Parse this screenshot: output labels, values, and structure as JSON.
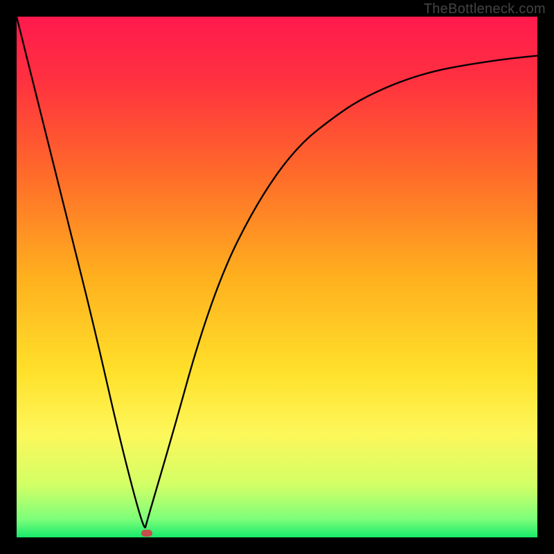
{
  "watermark": "TheBottleneck.com",
  "colors": {
    "frame": "#000000",
    "curve": "#000000",
    "marker": "#c44e4b",
    "gradient_stops": [
      {
        "offset": 0.0,
        "color": "#ff1a4d"
      },
      {
        "offset": 0.12,
        "color": "#ff3040"
      },
      {
        "offset": 0.3,
        "color": "#ff6a2a"
      },
      {
        "offset": 0.5,
        "color": "#ffb01e"
      },
      {
        "offset": 0.68,
        "color": "#ffe02a"
      },
      {
        "offset": 0.8,
        "color": "#fdf75a"
      },
      {
        "offset": 0.9,
        "color": "#d2ff66"
      },
      {
        "offset": 0.965,
        "color": "#7dff7a"
      },
      {
        "offset": 1.0,
        "color": "#17e96b"
      }
    ]
  },
  "chart_data": {
    "type": "line",
    "title": "",
    "xlabel": "",
    "ylabel": "",
    "xlim": [
      0,
      100
    ],
    "ylim": [
      0,
      100
    ],
    "grid": false,
    "legend": false,
    "series": [
      {
        "name": "bottleneck-curve",
        "x": [
          0,
          5,
          10,
          15,
          20,
          24.5,
          25,
          30,
          35,
          40,
          45,
          50,
          55,
          60,
          65,
          70,
          75,
          80,
          85,
          90,
          95,
          100
        ],
        "values": [
          100,
          80,
          60,
          40,
          18,
          1,
          3,
          20,
          38,
          52,
          62,
          70,
          76,
          80,
          83.5,
          86,
          88,
          89.5,
          90.5,
          91.3,
          92,
          92.5
        ]
      }
    ],
    "annotations": [
      {
        "name": "marker-min",
        "x": 25,
        "y": 0.8
      }
    ]
  }
}
